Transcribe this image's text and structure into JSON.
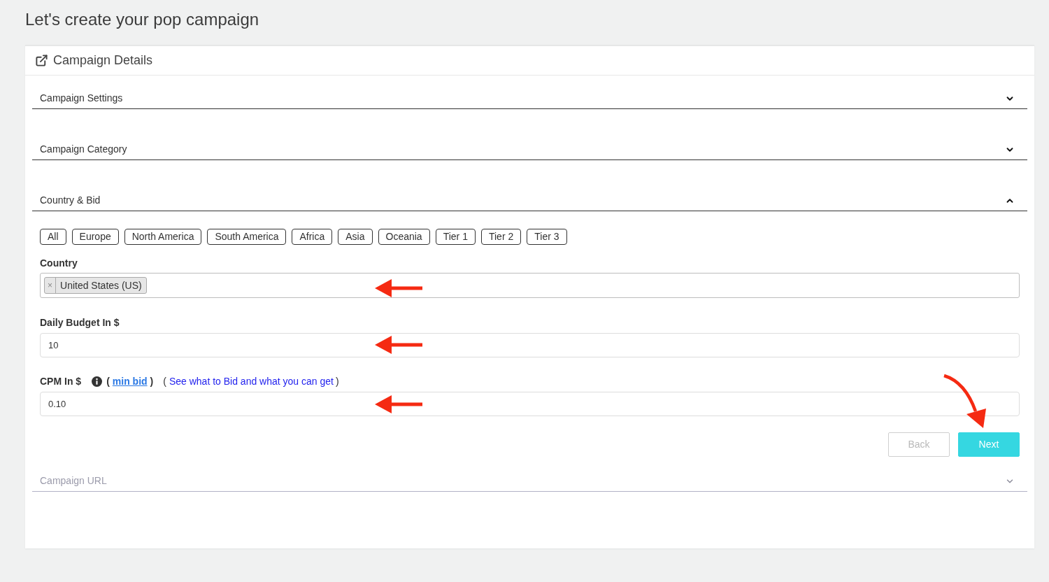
{
  "page": {
    "title": "Let's create your pop campaign"
  },
  "card": {
    "title": "Campaign Details"
  },
  "sections": [
    {
      "title": "Campaign Settings",
      "expanded": false,
      "disabled": false
    },
    {
      "title": "Campaign Category",
      "expanded": false,
      "disabled": false
    },
    {
      "title": "Country & Bid",
      "expanded": true,
      "disabled": false,
      "content": {
        "region_filters": [
          "All",
          "Europe",
          "North America",
          "South America",
          "Africa",
          "Asia",
          "Oceania",
          "Tier 1",
          "Tier 2",
          "Tier 3"
        ],
        "country": {
          "label": "Country",
          "tags": [
            {
              "remove": "×",
              "label": "United States (US)"
            }
          ]
        },
        "daily_budget": {
          "label": "Daily Budget In $",
          "value": "10"
        },
        "cpm": {
          "label": "CPM In $",
          "min_bid": {
            "open": "(",
            "link": "min bid",
            "close": ")"
          },
          "guide": {
            "open": "(",
            "link": "See what to Bid and what you can get",
            "close": ")"
          },
          "value": "0.10"
        },
        "buttons": [
          {
            "label": "Back",
            "kind": "secondary"
          },
          {
            "label": "Next",
            "kind": "primary"
          }
        ]
      }
    },
    {
      "title": "Campaign URL",
      "expanded": false,
      "disabled": true
    }
  ]
}
